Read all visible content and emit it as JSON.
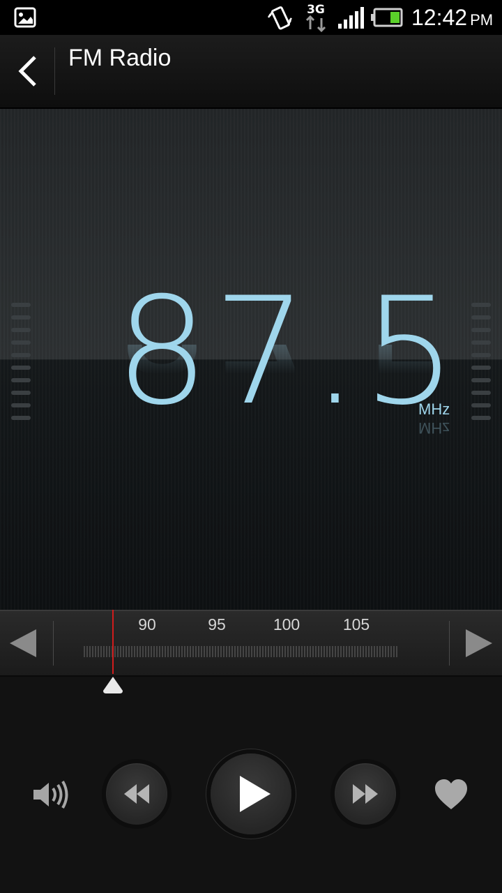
{
  "status_bar": {
    "time": "12:42",
    "ampm": "PM",
    "network": "3G",
    "icons": [
      "gallery-notification-icon",
      "vibrate-icon",
      "3g-data-icon",
      "signal-icon",
      "battery-icon"
    ]
  },
  "header": {
    "title": "FM Radio",
    "back_icon": "back-chevron-icon"
  },
  "radio": {
    "frequency": "87.5",
    "unit": "MHz",
    "tuner_labels": [
      "90",
      "95",
      "100",
      "105"
    ],
    "tuner_min_mhz": 87.5,
    "tuner_max_mhz": 108
  },
  "controls": {
    "volume_icon": "speaker-icon",
    "prev_icon": "rewind-icon",
    "play_icon": "play-icon",
    "next_icon": "fast-forward-icon",
    "favorite_icon": "heart-icon"
  },
  "colors": {
    "accent": "#9fd6ec",
    "needle": "#d11c1c"
  }
}
